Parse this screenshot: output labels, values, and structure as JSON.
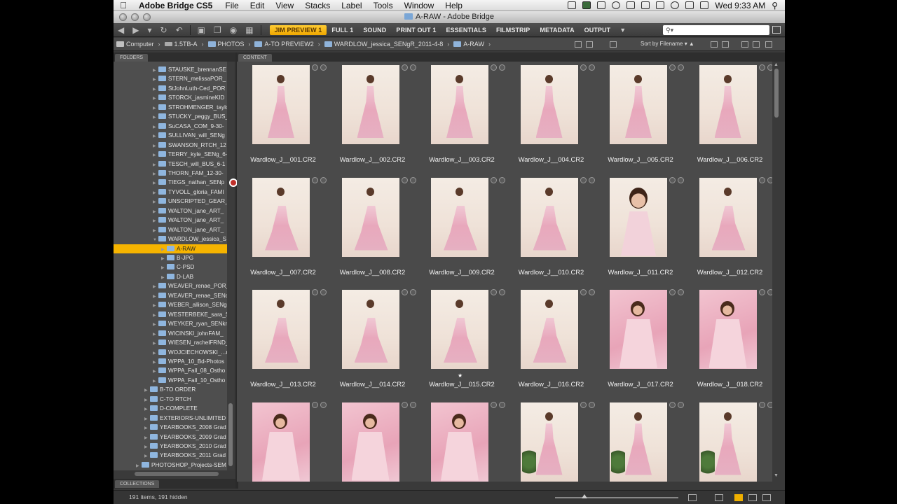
{
  "menubar": {
    "app_name": "Adobe Bridge CS5",
    "items": [
      "File",
      "Edit",
      "View",
      "Stacks",
      "Label",
      "Tools",
      "Window",
      "Help"
    ],
    "clock": "Wed 9:33 AM"
  },
  "window": {
    "title": "A-RAW - Adobe Bridge"
  },
  "workspaces": {
    "active": "JIM PREVIEW 1",
    "items": [
      "FULL 1",
      "SOUND",
      "PRINT OUT 1",
      "ESSENTIALS",
      "FILMSTRIP",
      "METADATA",
      "OUTPUT"
    ]
  },
  "search": {
    "placeholder": ""
  },
  "path": [
    "Computer",
    "1.5TB-A",
    "PHOTOS",
    "A-TO PREVIEW2",
    "WARDLOW_jessica_SENgR_2011-4-8",
    "A-RAW"
  ],
  "sort": {
    "label": "Sort by Filename"
  },
  "panels": {
    "folders": "FOLDERS",
    "content": "CONTENT",
    "collections": "COLLECTIONS"
  },
  "folders": [
    {
      "label": "STAUSKE_brennanSE",
      "level": 2
    },
    {
      "label": "STERN_melissaPOR_",
      "level": 2
    },
    {
      "label": "StJohnLuth-Ced_POR",
      "level": 2
    },
    {
      "label": "STORCK_jasmineKID",
      "level": 2
    },
    {
      "label": "STROHMENGER_taylo",
      "level": 2
    },
    {
      "label": "STUCKY_peggy_BUS_",
      "level": 2
    },
    {
      "label": "SuCASA_COM_9-30-",
      "level": 2
    },
    {
      "label": "SULLIVAN_will_SENg",
      "level": 2
    },
    {
      "label": "SWANSON_RTCH_12",
      "level": 2
    },
    {
      "label": "TERRY_kyle_SENg_6-",
      "level": 2
    },
    {
      "label": "TESCH_will_BUS_6-1",
      "level": 2
    },
    {
      "label": "THORN_FAM_12-30-",
      "level": 2
    },
    {
      "label": "TIEGS_nathan_SENp",
      "level": 2
    },
    {
      "label": "TYVOLL_gloria_FAMI",
      "level": 2
    },
    {
      "label": "UNSCRIPTED_GEAR_C",
      "level": 2
    },
    {
      "label": "WALTON_jane_ART_",
      "level": 2
    },
    {
      "label": "WALTON_jane_ART_",
      "level": 2
    },
    {
      "label": "WALTON_jane_ART_",
      "level": 2
    },
    {
      "label": "WARDLOW_jessica_S",
      "level": 2,
      "open": true
    },
    {
      "label": "A-RAW",
      "level": 3,
      "selected": true
    },
    {
      "label": "B-JPG",
      "level": 3
    },
    {
      "label": "C-PSD",
      "level": 3
    },
    {
      "label": "D-LAB",
      "level": 3
    },
    {
      "label": "WEAVER_renae_POR_",
      "level": 2
    },
    {
      "label": "WEAVER_renae_SENc",
      "level": 2
    },
    {
      "label": "WEBER_allison_SENg",
      "level": 2
    },
    {
      "label": "WESTERBEKE_sara_SE",
      "level": 2
    },
    {
      "label": "WEYKER_ryan_SENkm",
      "level": 2
    },
    {
      "label": "WICINSKI_johnFAM_",
      "level": 2
    },
    {
      "label": "WIESEN_rachelFRND_",
      "level": 2
    },
    {
      "label": "WOJCIECHOWSKI_...r",
      "level": 2
    },
    {
      "label": "WPPA_10_Bd-Photos",
      "level": 2
    },
    {
      "label": "WPPA_Fall_08_Ostho",
      "level": 2
    },
    {
      "label": "WPPA_Fall_10_Ostho",
      "level": 2
    },
    {
      "label": "B-TO ORDER",
      "level": 1
    },
    {
      "label": "C-TO RTCH",
      "level": 1
    },
    {
      "label": "D-COMPLETE",
      "level": 1
    },
    {
      "label": "EXTERIORS-UNLIMITED",
      "level": 1
    },
    {
      "label": "YEARBOOKS_2008 Grad",
      "level": 1
    },
    {
      "label": "YEARBOOKS_2009 Grad",
      "level": 1
    },
    {
      "label": "YEARBOOKS_2010 Grad",
      "level": 1
    },
    {
      "label": "YEARBOOKS_2011 Grad",
      "level": 1
    },
    {
      "label": "PHOTOSHOP_Projects-SEM",
      "level": 0
    }
  ],
  "thumbnails": [
    {
      "name": "Wardlow_J__001.CR2",
      "style": "stand"
    },
    {
      "name": "Wardlow_J__002.CR2",
      "style": "stand"
    },
    {
      "name": "Wardlow_J__003.CR2",
      "style": "stand"
    },
    {
      "name": "Wardlow_J__004.CR2",
      "style": "stand"
    },
    {
      "name": "Wardlow_J__005.CR2",
      "style": "stand"
    },
    {
      "name": "Wardlow_J__006.CR2",
      "style": "stand"
    },
    {
      "name": "Wardlow_J__007.CR2",
      "style": "sit"
    },
    {
      "name": "Wardlow_J__008.CR2",
      "style": "sit"
    },
    {
      "name": "Wardlow_J__009.CR2",
      "style": "sit"
    },
    {
      "name": "Wardlow_J__010.CR2",
      "style": "sit"
    },
    {
      "name": "Wardlow_J__011.CR2",
      "style": "portrait"
    },
    {
      "name": "Wardlow_J__012.CR2",
      "style": "sit"
    },
    {
      "name": "Wardlow_J__013.CR2",
      "style": "sit"
    },
    {
      "name": "Wardlow_J__014.CR2",
      "style": "sit"
    },
    {
      "name": "Wardlow_J__015.CR2",
      "style": "sit",
      "star": "★"
    },
    {
      "name": "Wardlow_J__016.CR2",
      "style": "sit"
    },
    {
      "name": "Wardlow_J__017.CR2",
      "style": "pink"
    },
    {
      "name": "Wardlow_J__018.CR2",
      "style": "pink"
    },
    {
      "name": "",
      "style": "pink"
    },
    {
      "name": "",
      "style": "pink"
    },
    {
      "name": "",
      "style": "pink"
    },
    {
      "name": "",
      "style": "garden"
    },
    {
      "name": "",
      "style": "garden"
    },
    {
      "name": "",
      "style": "garden"
    }
  ],
  "status": {
    "count": "191 items, 191 hidden"
  }
}
